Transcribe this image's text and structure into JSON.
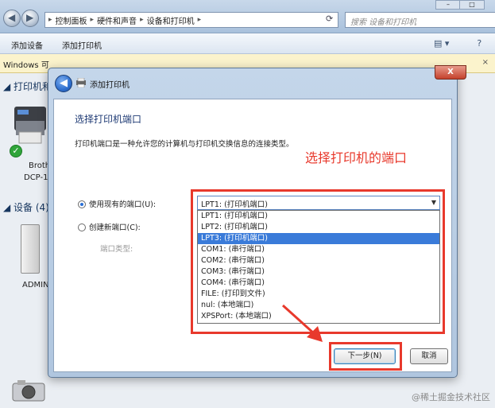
{
  "explorer": {
    "breadcrumb": [
      "控制面板",
      "硬件和声音",
      "设备和打印机"
    ],
    "search_placeholder": "搜索 设备和打印机",
    "toolbar": {
      "add_device": "添加设备",
      "add_printer": "添加打印机"
    },
    "infobar_text": "Windows 可",
    "sections": {
      "printers": "打印机和",
      "devices": "设备 (4)"
    },
    "printer_label_1": "Broth",
    "printer_label_2": "DCP-1",
    "device_label": "ADMIN"
  },
  "dialog": {
    "title": "添加打印机",
    "heading": "选择打印机端口",
    "description": "打印机端口是一种允许您的计算机与打印机交换信息的连接类型。",
    "use_existing_label": "使用现有的端口(U):",
    "create_new_label": "创建新端口(C):",
    "port_type_label": "端口类型:",
    "selected_port": "LPT1: (打印机端口)",
    "port_options": [
      "LPT1: (打印机端口)",
      "LPT2: (打印机端口)",
      "LPT3: (打印机端口)",
      "COM1: (串行端口)",
      "COM2: (串行端口)",
      "COM3: (串行端口)",
      "COM4: (串行端口)",
      "FILE: (打印到文件)",
      "nul: (本地端口)",
      "XPSPort: (本地端口)"
    ],
    "highlighted_option": "LPT3: (打印机端口)",
    "next_button": "下一步(N)",
    "cancel_button": "取消",
    "close_glyph": "X"
  },
  "annotation": "选择打印机的端口",
  "watermark": "@稀土掘金技术社区",
  "colors": {
    "annotation_red": "#e8392c",
    "selection_blue": "#3a7bd9"
  },
  "icons": [
    "back-arrow-icon",
    "forward-arrow-icon",
    "printer-icon",
    "check-icon",
    "computer-tower-icon",
    "camera-icon",
    "chevron-down-icon"
  ]
}
